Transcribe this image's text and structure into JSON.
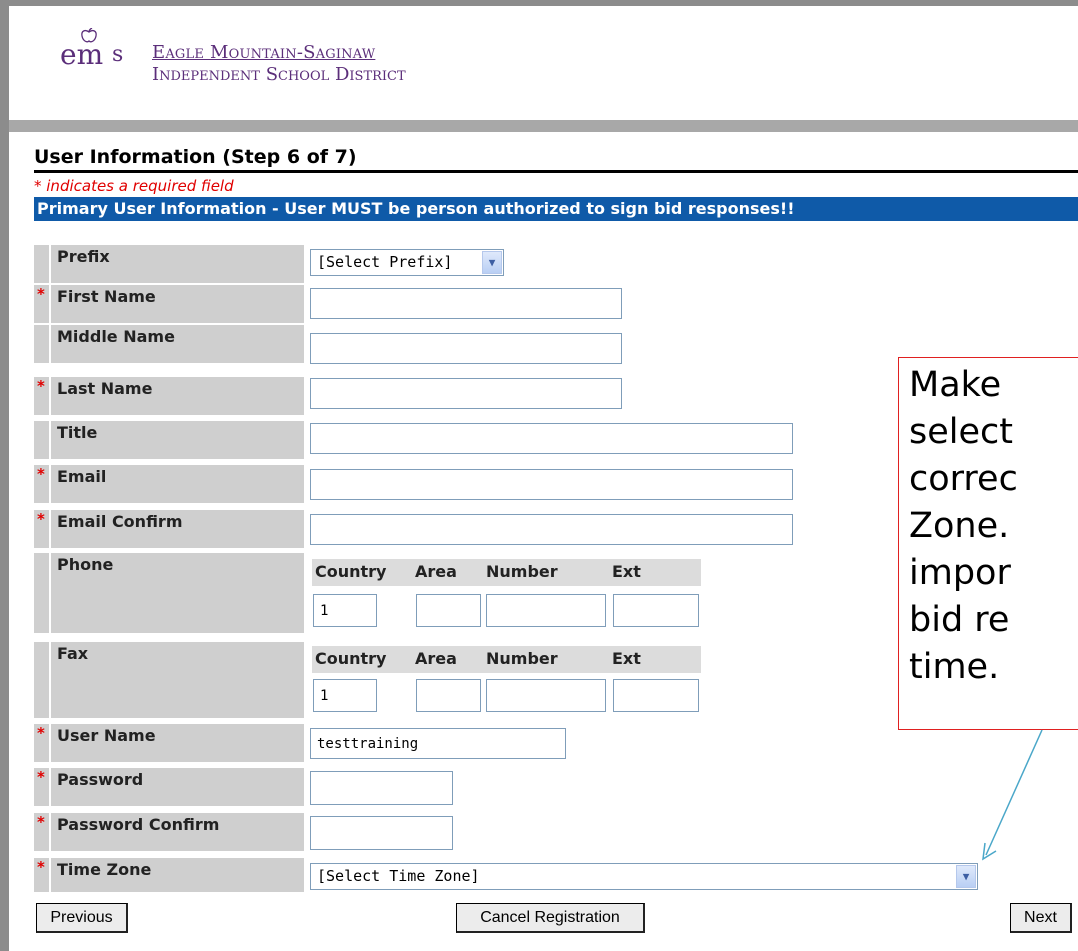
{
  "district": {
    "line1": "Eagle Mountain-Saginaw",
    "line2": "Independent School District",
    "logo_mark": "em",
    "logo_s": "s"
  },
  "page": {
    "title": "User Information (Step 6 of 7)",
    "required_note": "* indicates a required field"
  },
  "section": {
    "title": "Primary User Information - User MUST be person authorized to sign bid responses!!"
  },
  "required_star": "*",
  "fields": {
    "prefix": {
      "label": "Prefix",
      "value": "[Select Prefix]"
    },
    "first_name": {
      "label": "First Name",
      "value": ""
    },
    "middle_name": {
      "label": "Middle Name",
      "value": ""
    },
    "last_name": {
      "label": "Last Name",
      "value": ""
    },
    "title": {
      "label": "Title",
      "value": ""
    },
    "email": {
      "label": "Email",
      "value": ""
    },
    "email_confirm": {
      "label": "Email Confirm",
      "value": ""
    },
    "phone": {
      "label": "Phone",
      "country": "1",
      "area": "",
      "number": "",
      "ext": ""
    },
    "fax": {
      "label": "Fax",
      "country": "1",
      "area": "",
      "number": "",
      "ext": ""
    },
    "user_name": {
      "label": "User Name",
      "value": "testtraining"
    },
    "password": {
      "label": "Password",
      "value": ""
    },
    "password_confirm": {
      "label": "Password Confirm",
      "value": ""
    },
    "time_zone": {
      "label": "Time Zone",
      "value": "[Select Time Zone]"
    }
  },
  "phone_columns": {
    "country": "Country",
    "area": "Area",
    "number": "Number",
    "ext": "Ext"
  },
  "buttons": {
    "previous": "Previous",
    "cancel": "Cancel Registration",
    "next": "Next"
  },
  "callout": {
    "lines": [
      "Make",
      "select",
      "correc",
      "Zone.",
      "impor",
      "bid re",
      "time."
    ]
  },
  "colors": {
    "section_bar": "#0f5aa8",
    "required": "#e00000",
    "label_bg": "#cfcfcf",
    "logo": "#5b2e7a",
    "callout_border": "#e02020",
    "connector": "#4aa7c9"
  },
  "icons": {
    "dropdown": "chevron-down-icon",
    "logo_apple": "apple-icon"
  }
}
